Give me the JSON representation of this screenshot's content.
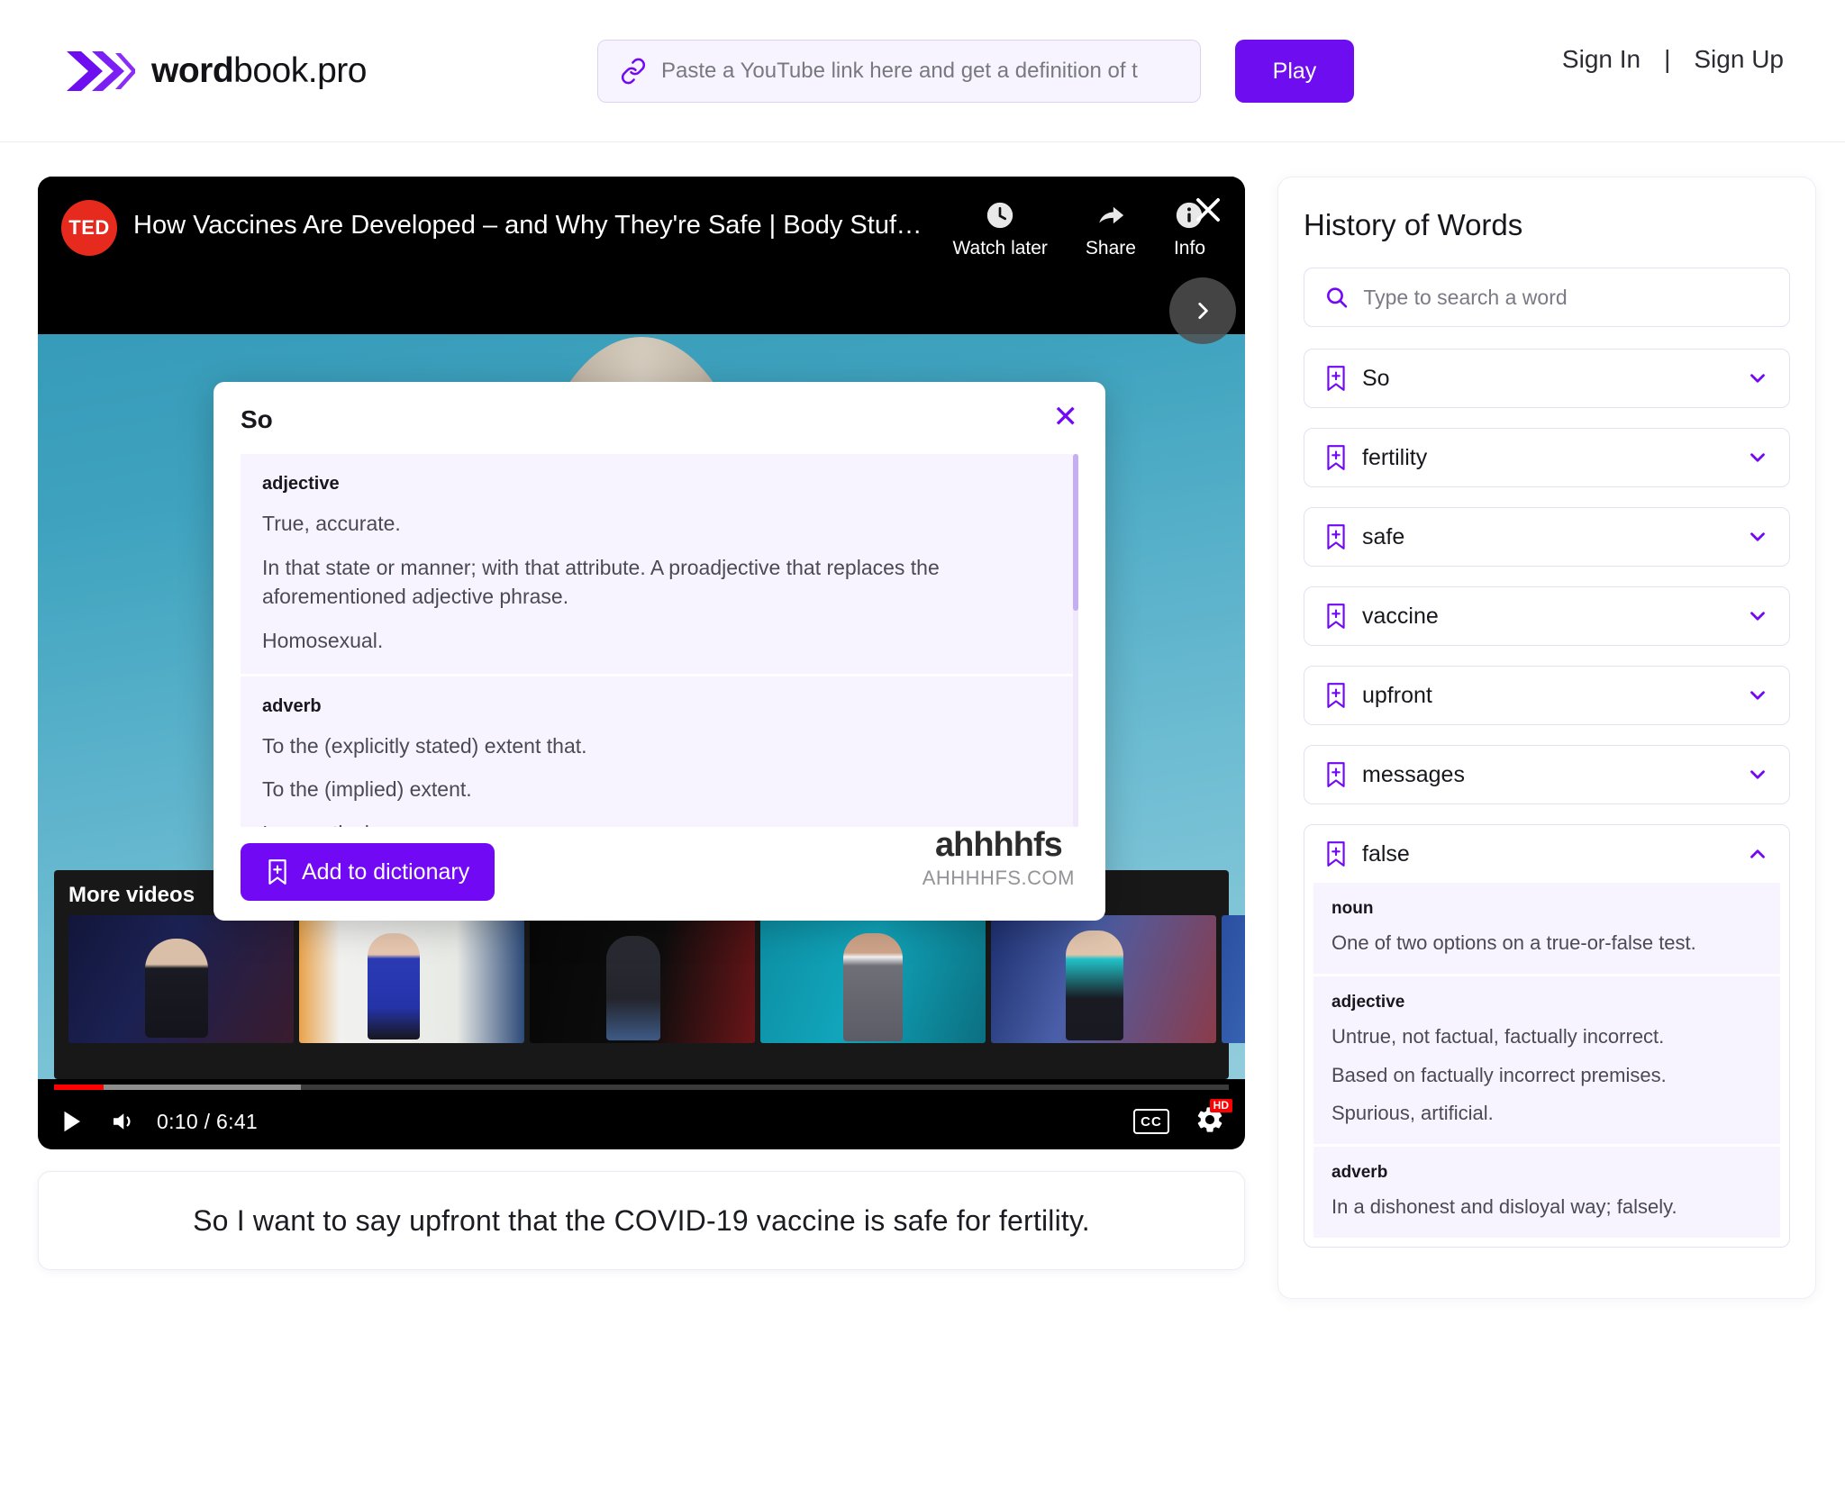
{
  "brand": {
    "name_bold": "word",
    "name_light": "book.pro"
  },
  "header": {
    "url_placeholder": "Paste a YouTube link here and get a definition of t",
    "url_value": "",
    "play_label": "Play",
    "sign_in": "Sign In",
    "divider": "|",
    "sign_up": "Sign Up"
  },
  "video": {
    "channel_badge": "TED",
    "title": "How Vaccines Are Developed – and Why They're Safe | Body Stuff with Dr. Jen G...",
    "actions": [
      {
        "label": "Watch later",
        "icon": "clock-icon"
      },
      {
        "label": "Share",
        "icon": "share-icon"
      },
      {
        "label": "Info",
        "icon": "info-icon"
      }
    ],
    "more_videos_label": "More videos",
    "current_time": "0:10",
    "duration": "6:41",
    "time_display": "0:10 / 6:41",
    "cc_label": "CC",
    "hd_label": "HD"
  },
  "popup": {
    "word": "So",
    "close_label": "✕",
    "add_button": "Add to dictionary",
    "senses": [
      {
        "pos": "adjective",
        "definitions": [
          "True, accurate.",
          "In that state or manner; with that attribute. A proadjective that replaces the aforementioned adjective phrase.",
          "Homosexual."
        ]
      },
      {
        "pos": "adverb",
        "definitions": [
          "To the (explicitly stated) extent that.",
          "To the (implied) extent.",
          "In a particular manner."
        ]
      }
    ]
  },
  "watermark": {
    "logo": "ahhhhfs",
    "domain": "AHHHHFS.COM"
  },
  "subtitle": {
    "text": "So I want to say upfront that the COVID-19 vaccine is safe for fertility."
  },
  "sidebar": {
    "title": "History of Words",
    "search_placeholder": "Type to search a word",
    "search_value": "",
    "words": [
      {
        "word": "So",
        "expanded": false,
        "senses": []
      },
      {
        "word": "fertility",
        "expanded": false,
        "senses": []
      },
      {
        "word": "safe",
        "expanded": false,
        "senses": []
      },
      {
        "word": "vaccine",
        "expanded": false,
        "senses": []
      },
      {
        "word": "upfront",
        "expanded": false,
        "senses": []
      },
      {
        "word": "messages",
        "expanded": false,
        "senses": []
      },
      {
        "word": "false",
        "expanded": true,
        "senses": [
          {
            "pos": "noun",
            "definitions": [
              "One of two options on a true-or-false test."
            ]
          },
          {
            "pos": "adjective",
            "definitions": [
              "Untrue, not factual, factually incorrect.",
              "Based on factually incorrect premises.",
              "Spurious, artificial."
            ]
          },
          {
            "pos": "adverb",
            "definitions": [
              "In a dishonest and disloyal way; falsely."
            ]
          }
        ]
      }
    ]
  },
  "colors": {
    "accent": "#7209f5",
    "accent_dark": "#6d0df0",
    "accent_soft": "#f8f4ff",
    "border_soft": "#e6dff5",
    "red": "#ff0000"
  }
}
